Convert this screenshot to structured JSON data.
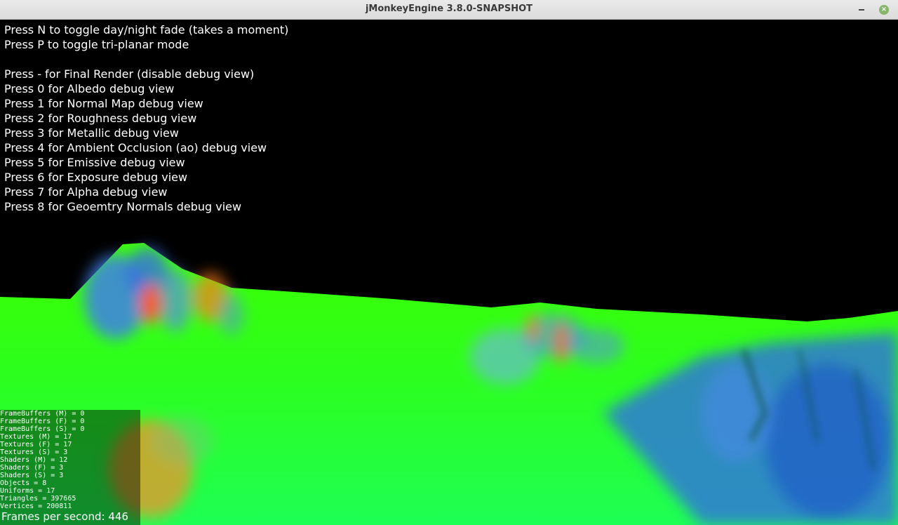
{
  "window": {
    "title": "jMonkeyEngine 3.8.0-SNAPSHOT",
    "minimize_label": "–",
    "close_label": "×"
  },
  "hud": {
    "lines": [
      "Press N to toggle day/night fade (takes a moment)",
      "Press P to toggle tri-planar mode",
      "",
      "Press - for Final Render (disable debug view)",
      "Press 0 for Albedo debug view",
      "Press 1 for Normal Map debug view",
      "Press 2 for Roughness debug view",
      "Press 3 for Metallic debug view",
      "Press 4 for Ambient Occlusion (ao) debug view",
      "Press 5 for Emissive debug view",
      "Press 6 for Exposure debug view",
      "Press 7 for Alpha debug view",
      "Press 8 for Geoemtry Normals debug view"
    ]
  },
  "stats": {
    "lines": [
      "FrameBuffers (M) = 0",
      "FrameBuffers (F) = 0",
      "FrameBuffers (S) = 0",
      "Textures (M) = 17",
      "Textures (F) = 17",
      "Textures (S) = 3",
      "Shaders (M) = 12",
      "Shaders (F) = 3",
      "Shaders (S) = 3",
      "Objects = 8",
      "Uniforms = 17",
      "Triangles = 397665",
      "Vertices = 200811"
    ],
    "fps": "Frames per second: 446"
  },
  "colors": {
    "terrain_green": "#22ff00",
    "terrain_blue": "#2f6fe0",
    "terrain_orange": "#ff6a1a",
    "close_button": "#86b66a"
  }
}
